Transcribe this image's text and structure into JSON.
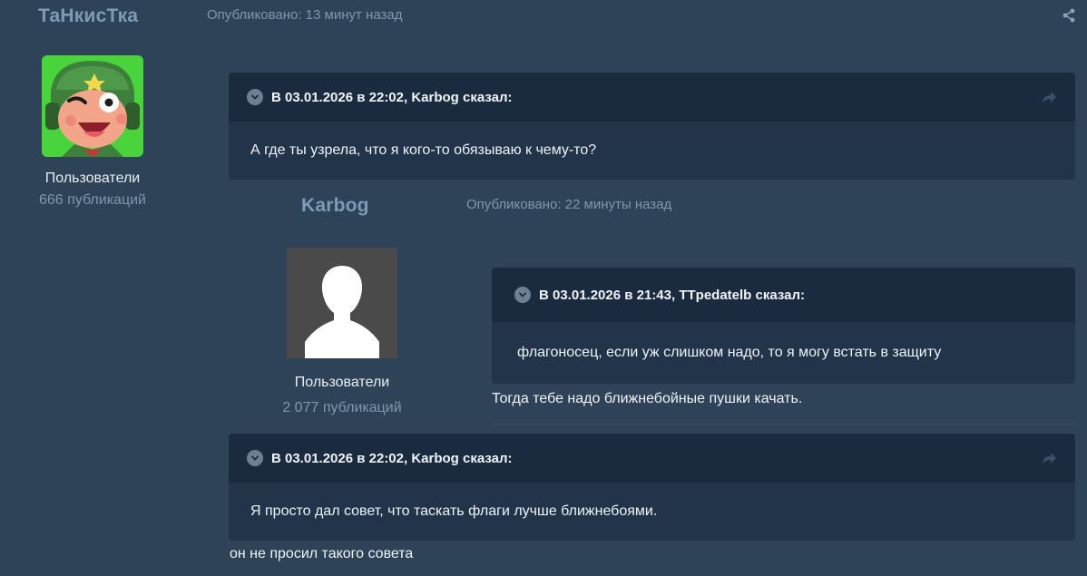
{
  "post1": {
    "author": "ТаНкисТка",
    "published": "Опубликовано: 13 минут назад",
    "group": "Пользователи",
    "posts_count": "666 публикаций",
    "avatar_icon": "cartoon-soldier-avatar",
    "quote": {
      "header": "В 03.01.2026 в 22:02, Karbog сказал:",
      "text": "А где ты узрела, что я кого-то обязываю к чему-то?"
    }
  },
  "post2": {
    "author": "Karbog",
    "published": "Опубликовано: 22 минуты назад",
    "group": "Пользователи",
    "posts_count": "2 077 публикаций",
    "avatar_icon": "default-user-silhouette",
    "quote": {
      "header": "В 03.01.2026 в 21:43, TTpedatelb сказал:",
      "text": "флагоносец, если уж слишком надо, то я могу встать в защиту"
    },
    "reply": "Тогда тебе надо ближнебойные пушки качать."
  },
  "post3": {
    "quote": {
      "header": "В 03.01.2026 в 22:02, Karbog сказал:",
      "text": "Я просто дал совет, что таскать флаги лучше ближнебоями."
    },
    "reply": "он не просил такого совета"
  },
  "colors": {
    "background": "#2e4258",
    "quote_header": "#1b2b3f",
    "quote_body": "#22344a",
    "author": "#7e9bb8",
    "muted": "#7f97ae"
  }
}
